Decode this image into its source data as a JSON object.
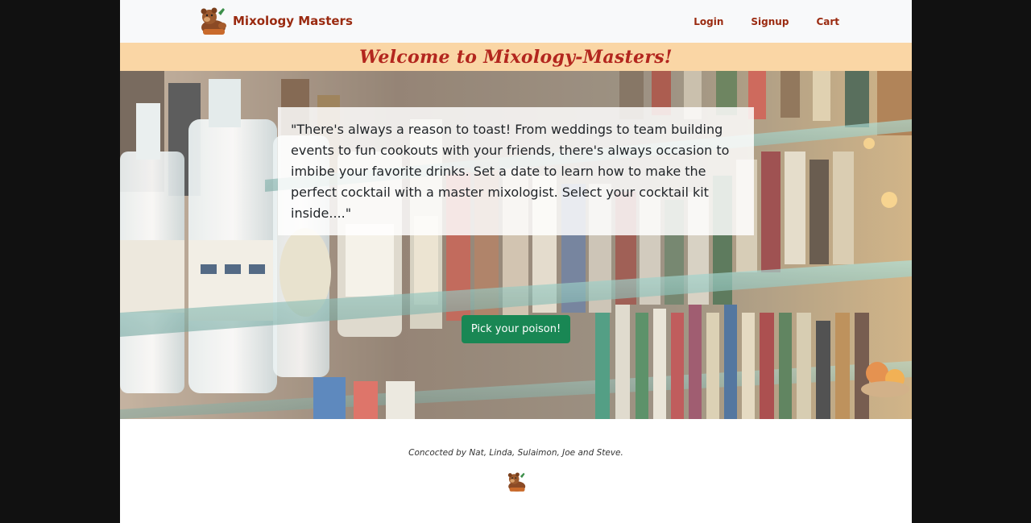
{
  "navbar": {
    "brand_name": "Mixology Masters",
    "brand_icon": "bear-mascot-icon",
    "links": {
      "login": "Login",
      "signup": "Signup",
      "cart": "Cart"
    }
  },
  "banner": {
    "title": "Welcome to Mixology-Masters!"
  },
  "hero": {
    "background": "bar-shelves-bottles-photo",
    "quote": "\"There's always a reason to toast! From weddings to team building events to fun cookouts with your friends, there's always occasion to imbibe your favorite drinks. Set a date to learn how to make the perfect cocktail with a master mixologist. Select your cocktail kit inside....\"",
    "cta_label": "Pick your poison!"
  },
  "footer": {
    "credit": "Concocted by Nat, Linda, Sulaimon, Joe and Steve.",
    "icon": "bear-mascot-icon"
  },
  "colors": {
    "brand": "#9a2a10",
    "banner_bg": "#fad6a5",
    "banner_text": "#b3261e",
    "cta": "#198754",
    "navbar_bg": "#f8f9fa"
  }
}
